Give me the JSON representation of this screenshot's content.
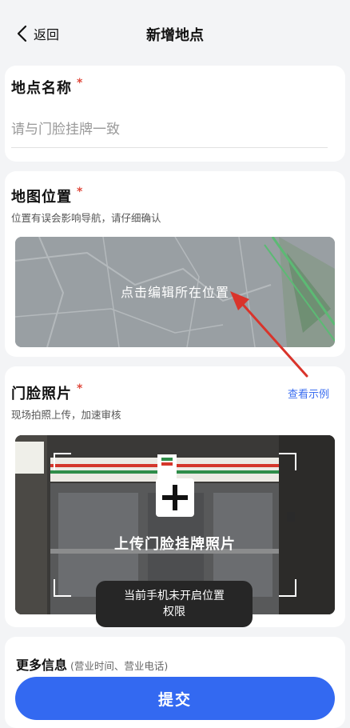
{
  "nav": {
    "back_label": "返回",
    "title": "新增地点"
  },
  "name_section": {
    "label": "地点名称",
    "required_mark": "*",
    "placeholder": "请与门脸挂牌一致"
  },
  "map_section": {
    "label": "地图位置",
    "required_mark": "*",
    "hint": "位置有误会影响导航，请仔细确认",
    "map_button": "点击编辑所在位置"
  },
  "photo_section": {
    "label": "门脸照片",
    "required_mark": "*",
    "hint": "现场拍照上传，加速审核",
    "example_link": "查看示例",
    "upload_label": "上传门脸挂牌照片"
  },
  "toast": {
    "line1": "当前手机未开启位置",
    "line2": "权限"
  },
  "more_section": {
    "label": "更多信息",
    "sub": "(营业时间、营业电话)"
  },
  "submit_label": "提交",
  "colors": {
    "accent": "#3369f1",
    "required": "#e0493c",
    "link": "#3b6ef0",
    "annotation_arrow": "#d9342b"
  }
}
